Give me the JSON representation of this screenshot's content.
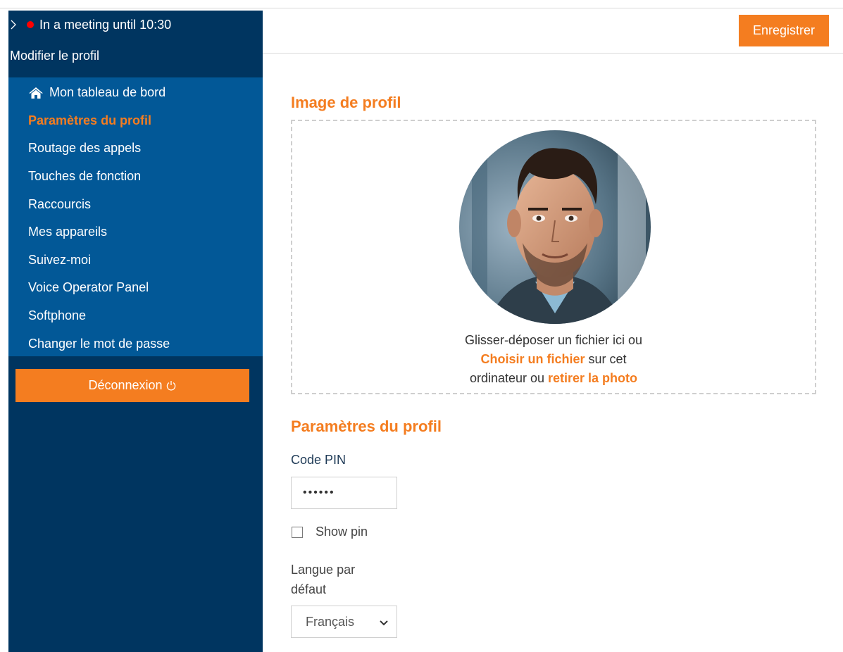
{
  "sidebar": {
    "status_text": "In a meeting until 10:30",
    "status_color": "#ff0000",
    "title": "Modifier le profil",
    "items": [
      {
        "label": "Mon tableau de bord",
        "icon": "home-icon"
      },
      {
        "label": "Paramètres du profil",
        "active": true
      },
      {
        "label": "Routage des appels"
      },
      {
        "label": "Touches de fonction"
      },
      {
        "label": "Raccourcis"
      },
      {
        "label": "Mes appareils"
      },
      {
        "label": "Suivez-moi"
      },
      {
        "label": "Voice Operator Panel"
      },
      {
        "label": "Softphone"
      },
      {
        "label": "Changer le mot de passe"
      }
    ],
    "logout_label": "Déconnexion",
    "logout_icon": "power-icon"
  },
  "header": {
    "save_label": "Enregistrer"
  },
  "profile_image": {
    "title": "Image de profil",
    "drop_text_1": "Glisser-déposer un fichier ici ou",
    "choose_file": "Choisir un fichier",
    "drop_text_2": " sur cet",
    "drop_text_3": "ordinateur ou ",
    "remove_photo": "retirer la photo"
  },
  "profile_settings": {
    "title": "Paramètres du profil",
    "pin_label": "Code PIN",
    "pin_value": "••••••",
    "show_pin_label": "Show pin",
    "language_label": "Langue par défaut",
    "language_value": "Français"
  },
  "colors": {
    "accent": "#f47d20",
    "sidebar_dark": "#003560",
    "sidebar_menu": "#025897"
  }
}
